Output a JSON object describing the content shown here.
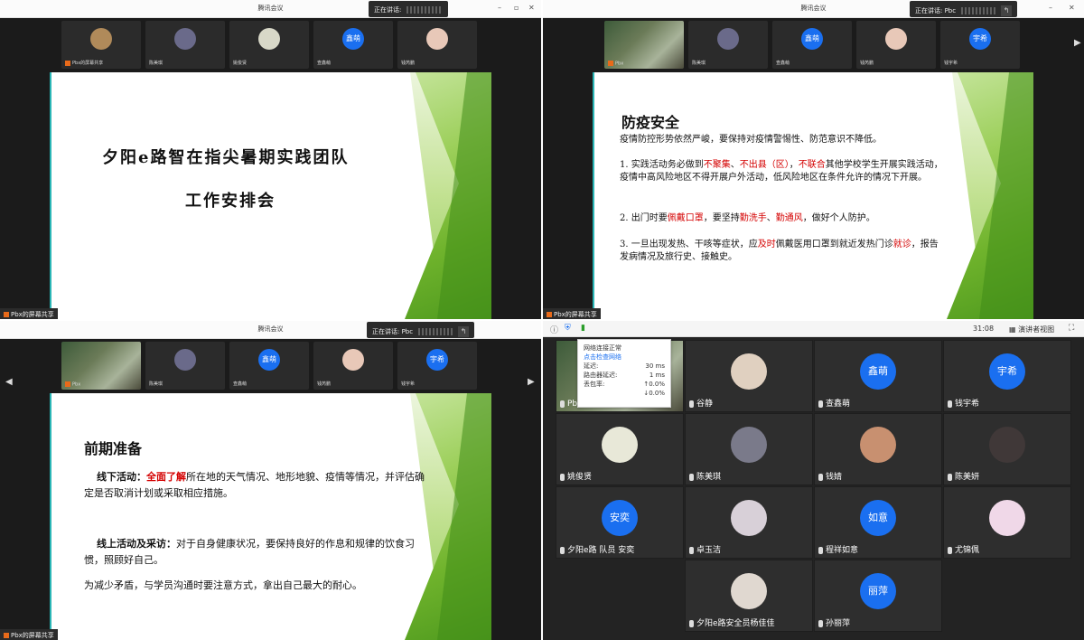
{
  "app_title": "腾讯会议",
  "speaking_label": "正在讲话:",
  "speaking_name_pbc": "正在讲话: Pbc",
  "screen_share_label": "Pbx的屏幕共享",
  "q1": {
    "strip": [
      {
        "name": "Pbx的屏幕共享",
        "type": "img",
        "color": "#b08a5a"
      },
      {
        "name": "陈美琪",
        "type": "img",
        "color": "#6a6a8a"
      },
      {
        "name": "姚俊贤",
        "type": "img",
        "color": "#d8d8c8"
      },
      {
        "name": "查鑫萌",
        "type": "blue",
        "initials": "鑫萌"
      },
      {
        "name": "钱芮鹏",
        "type": "img",
        "color": "#e8c8b8"
      }
    ],
    "self_name": "Pbx",
    "slide_title": "夕阳e路智在指尖暑期实践团队",
    "slide_subtitle": "工作安排会"
  },
  "q2": {
    "strip": [
      {
        "name": "Pbx",
        "type": "cam"
      },
      {
        "name": "陈美琪",
        "type": "img",
        "color": "#6a6a8a"
      },
      {
        "name": "查鑫萌",
        "type": "blue",
        "initials": "鑫萌"
      },
      {
        "name": "钱芮鹏",
        "type": "img",
        "color": "#e8c8b8"
      },
      {
        "name": "钱宇希",
        "type": "blue",
        "initials": "宇希"
      }
    ],
    "slide_heading": "防疫安全",
    "intro": "疫情防控形势依然严峻，要保持对疫情警惕性、防范意识不降低。",
    "p1_a": "1. 实践活动务必做到",
    "p1_r1": "不聚集",
    "p1_s1": "、",
    "p1_r2": "不出县（区）",
    "p1_s2": "，",
    "p1_r3": "不联合",
    "p1_b": "其他学校学生开展实践活动，疫情中高风险地区不得开展户外活动，低风险地区在条件允许的情况下开展。",
    "p2_a": "2. 出门时要",
    "p2_r1": "佩戴口罩",
    "p2_b": "，要坚持",
    "p2_r2": "勤洗手",
    "p2_s": "、",
    "p2_r3": "勤通风",
    "p2_c": "，做好个人防护。",
    "p3_a": "3. 一旦出现发热、干咳等症状，应",
    "p3_r1": "及时",
    "p3_b": "佩戴医用口罩到就近发热门诊",
    "p3_r2": "就诊",
    "p3_c": "，报告发病情况及旅行史、接触史。"
  },
  "q3": {
    "strip": [
      {
        "name": "Pbx",
        "type": "cam"
      },
      {
        "name": "陈美琪",
        "type": "img",
        "color": "#6a6a8a"
      },
      {
        "name": "查鑫萌",
        "type": "blue",
        "initials": "鑫萌"
      },
      {
        "name": "钱芮鹏",
        "type": "img",
        "color": "#e8c8b8"
      },
      {
        "name": "钱宇希",
        "type": "blue",
        "initials": "宇希"
      }
    ],
    "slide_heading": "前期准备",
    "offline_label": "线下活动：",
    "offline_red": "全面了解",
    "offline_text": "所在地的天气情况、地形地貌、疫情等情况，并评估确定是否取消计划或采取相应措施。",
    "online_label": "线上活动及采访：",
    "online_text": "对于自身健康状况，要保持良好的作息和规律的饮食习惯，照顾好自己。",
    "last_line": "为减少矛盾，与学员沟通时要注意方式，拿出自己最大的耐心。"
  },
  "q4": {
    "timer": "31:08",
    "view_label": "演讲者视图",
    "net": {
      "title": "网络连接正常",
      "link": "点击检查网络",
      "rows": [
        {
          "k": "延迟:",
          "v": "30 ms"
        },
        {
          "k": "路由器延迟:",
          "v": "1 ms"
        },
        {
          "k": "丢包率:",
          "v": "↑0.0%"
        },
        {
          "k": "",
          "v": "↓0.0%"
        }
      ]
    },
    "grid": [
      {
        "name": "Pbx",
        "type": "cam"
      },
      {
        "name": "谷静",
        "type": "img",
        "color": "#e0d0c0"
      },
      {
        "name": "查鑫萌",
        "type": "blue",
        "initials": "鑫萌"
      },
      {
        "name": "钱宇希",
        "type": "blue",
        "initials": "宇希"
      },
      {
        "name": "姚俊贤",
        "type": "img",
        "color": "#e8e8d8"
      },
      {
        "name": "陈美琪",
        "type": "img",
        "color": "#7a7a8a"
      },
      {
        "name": "钱婧",
        "type": "img",
        "color": "#c89070"
      },
      {
        "name": "陈美妍",
        "type": "img",
        "color": "#403838"
      },
      {
        "name": "夕阳e路 队员 安奕",
        "type": "blue",
        "initials": "安奕"
      },
      {
        "name": "卓玉洁",
        "type": "img",
        "color": "#d8d0d8"
      },
      {
        "name": "程祥如意",
        "type": "blue",
        "initials": "如意"
      },
      {
        "name": "尤锦佩",
        "type": "img",
        "color": "#f0d8e8"
      },
      {
        "name": "夕阳e路安全员杨佳佳",
        "type": "img",
        "color": "#e0d8d0"
      },
      {
        "name": "孙丽萍",
        "type": "blue",
        "initials": "丽萍"
      }
    ]
  }
}
